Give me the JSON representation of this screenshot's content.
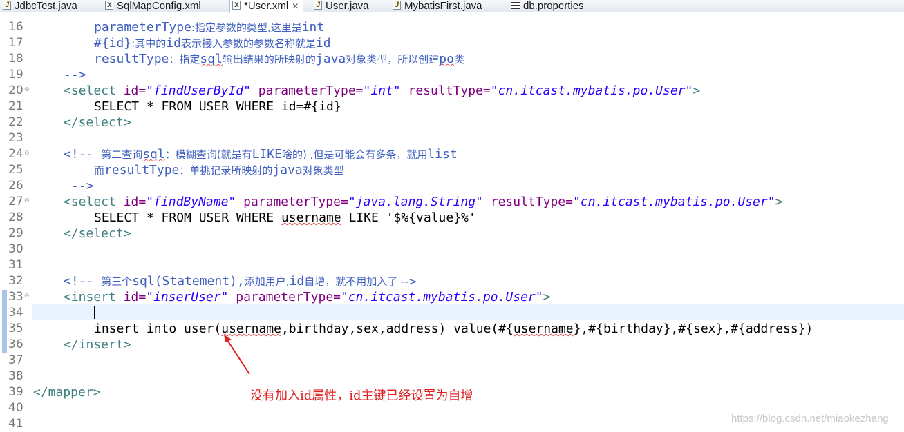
{
  "tabs": [
    {
      "label": "JdbcTest.java",
      "icon": "java-file-icon"
    },
    {
      "label": "SqlMapConfig.xml",
      "icon": "xml-file-icon"
    },
    {
      "label": "*User.xml",
      "icon": "xml-file-icon",
      "active": true
    },
    {
      "label": "User.java",
      "icon": "java-file-icon"
    },
    {
      "label": "MybatisFirst.java",
      "icon": "java-file-icon"
    },
    {
      "label": "db.properties",
      "icon": "properties-file-icon"
    }
  ],
  "lines": {
    "l16": {
      "n": "16",
      "a": "parameterType",
      "b": ":指定参数的类型,这里是",
      "c": "int"
    },
    "l17": {
      "n": "17",
      "a": "#{id}",
      "b": ":其中的",
      "c": "id",
      "d": "表示接入参数的参数名称就是",
      "e": "id"
    },
    "l18": {
      "n": "18",
      "a": "resultType",
      "b": "：指定",
      "c": "sql",
      "d": "输出结果的所映射的",
      "e": "java",
      "f": "对象类型，所以创建",
      "g": "po",
      "h": "类"
    },
    "l19": {
      "n": "19",
      "a": "-->"
    },
    "l20": {
      "n": "20",
      "a": "<select ",
      "b": "id=",
      "c": "\"findUserById\"",
      "d": " parameterType=",
      "e": "\"int\"",
      "f": " resultType=",
      "g": "\"cn.itcast.mybatis.po.User\"",
      "h": ">"
    },
    "l21": {
      "n": "21",
      "a": "SELECT * FROM USER WHERE id=#{id}"
    },
    "l22": {
      "n": "22",
      "a": "</select>"
    },
    "l23": {
      "n": "23"
    },
    "l24": {
      "n": "24",
      "a": "<!-- ",
      "b": "第二查询",
      "c": "sql",
      "d": "：模糊查询(就是有",
      "e": "LIKE",
      "f": "啥的) ,但是可能会有多条，就用",
      "g": "list"
    },
    "l25": {
      "n": "25",
      "a": "而",
      "b": "resultType",
      "c": "：单挑记录所映射的",
      "d": "java",
      "e": "对象类型"
    },
    "l26": {
      "n": "26",
      "a": "-->"
    },
    "l27": {
      "n": "27",
      "a": "<select ",
      "b": "id=",
      "c": "\"findByName\"",
      "d": " parameterType=",
      "e": "\"java.lang.String\"",
      "f": " resultType=",
      "g": "\"cn.itcast.mybatis.po.User\"",
      "h": ">"
    },
    "l28": {
      "n": "28",
      "a": "SELECT * FROM USER WHERE ",
      "b": "username",
      "c": " LIKE '$%{value}%'"
    },
    "l29": {
      "n": "29",
      "a": "</select>"
    },
    "l30": {
      "n": "30"
    },
    "l31": {
      "n": "31"
    },
    "l32": {
      "n": "32",
      "a": "<!-- ",
      "b": "第三个",
      "c": "sql(Statement),",
      "d": "添加用户,",
      "e": "id",
      "f": "自增，就不用加入了 -->"
    },
    "l33": {
      "n": "33",
      "a": "<insert ",
      "b": "id=",
      "c": "\"inserUser\"",
      "d": " parameterType=",
      "e": "\"cn.itcast.mybatis.po.User\"",
      "f": ">"
    },
    "l34": {
      "n": "34"
    },
    "l35": {
      "n": "35",
      "a": "insert into user(",
      "b": "username",
      "c": ",birthday,sex,address) value(#{",
      "d": "username",
      "e": "},#{birthday},#{sex},#{address})"
    },
    "l36": {
      "n": "36",
      "a": "</insert>"
    },
    "l37": {
      "n": "37"
    },
    "l38": {
      "n": "38"
    },
    "l39": {
      "n": "39",
      "a": "</mapper>"
    },
    "l40": {
      "n": "40"
    },
    "l41": {
      "n": "41"
    }
  },
  "annotation": "没有加入id属性，id主键已经设置为自增",
  "watermark": "https://blog.csdn.net/miaokezhang",
  "colors": {
    "tag": "#3f7f7f",
    "attribute": "#7f007f",
    "value": "#2a00ff",
    "comment": "#3f5fbf",
    "annotation": "#e02020",
    "current_line": "#e8f2fe"
  }
}
